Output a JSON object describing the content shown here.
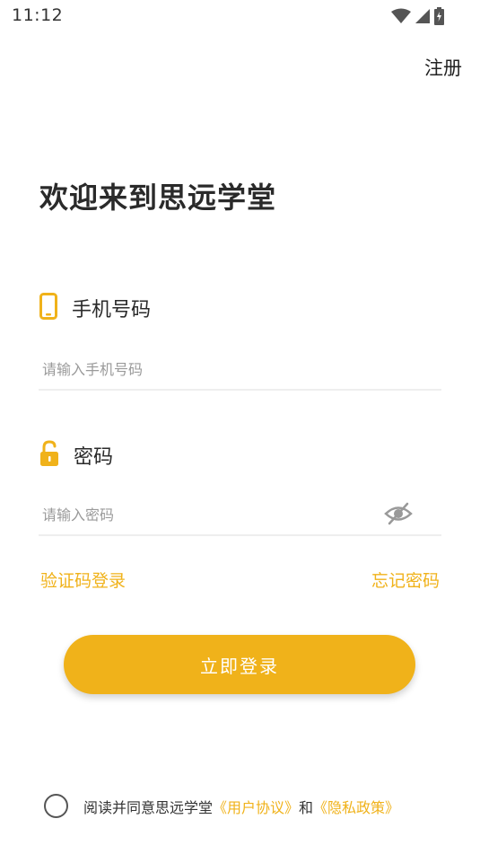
{
  "status_bar": {
    "time": "11:12",
    "icons": [
      "wifi-icon",
      "signal-icon",
      "battery-charging-icon"
    ]
  },
  "header": {
    "register_label": "注册"
  },
  "welcome": {
    "title": "欢迎来到思远学堂"
  },
  "phone_field": {
    "label": "手机号码",
    "icon": "phone-icon",
    "placeholder": "请输入手机号码",
    "value": ""
  },
  "password_field": {
    "label": "密码",
    "icon": "unlock-icon",
    "placeholder": "请输入密码",
    "value": "",
    "toggle_icon": "eye-off-icon"
  },
  "links": {
    "sms_login": "验证码登录",
    "forgot_password": "忘记密码"
  },
  "login_button": {
    "label": "立即登录"
  },
  "agreement": {
    "prefix": "阅读并同意思远学堂",
    "user_agreement": "《用户协议》",
    "joiner": "和",
    "privacy_policy": "《隐私政策》",
    "checked": false
  },
  "colors": {
    "accent": "#f0b21a",
    "text": "#222222",
    "placeholder": "#9a9a9a",
    "divider": "#eeeeee"
  }
}
